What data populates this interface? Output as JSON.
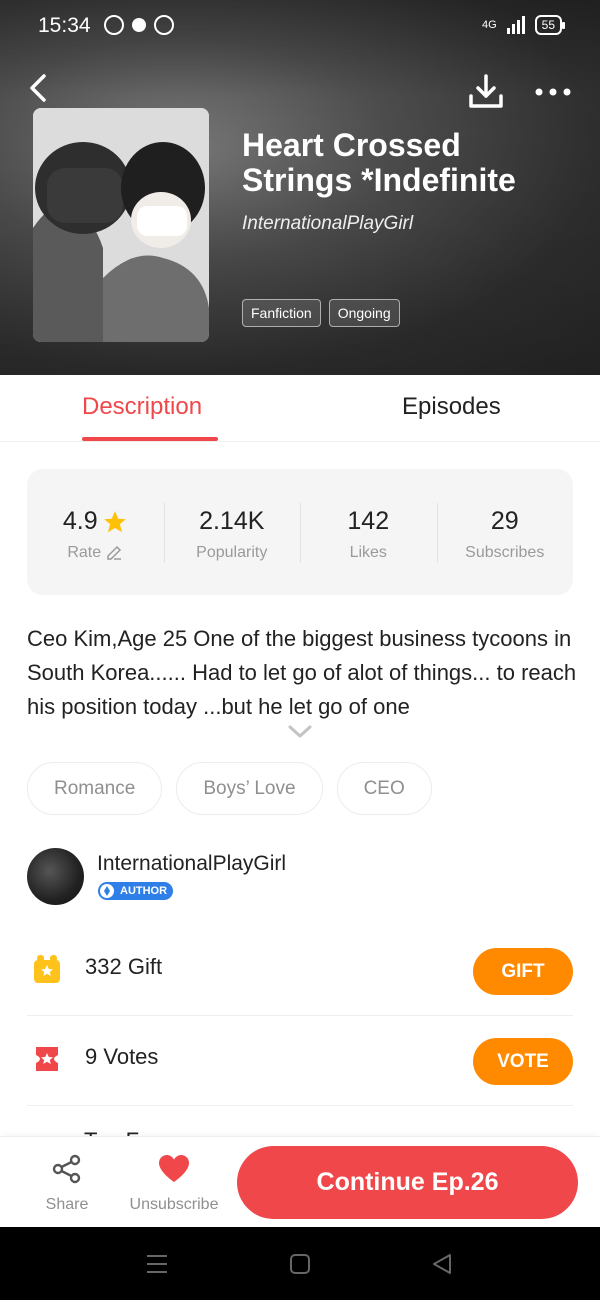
{
  "status_bar": {
    "time": "15:34",
    "network": "4G",
    "battery": "55"
  },
  "book": {
    "title": "Heart Crossed Strings *Indefinite",
    "author": "InternationalPlayGirl",
    "tags": [
      "Fanfiction",
      "Ongoing"
    ]
  },
  "tabs": {
    "description": "Description",
    "episodes": "Episodes"
  },
  "stats": [
    {
      "value": "4.9",
      "label": "Rate"
    },
    {
      "value": "2.14K",
      "label": "Popularity"
    },
    {
      "value": "142",
      "label": "Likes"
    },
    {
      "value": "29",
      "label": "Subscribes"
    }
  ],
  "synopsis": "Ceo Kim,Age 25 One of the biggest business tycoons in South Korea...... Had to let go of alot of things... to reach his position today ...but he let go of one",
  "keywords": [
    "Romance",
    "Boys’ Love",
    "CEO"
  ],
  "author_section": {
    "name": "InternationalPlayGirl",
    "badge": "AUTHOR"
  },
  "gift": {
    "count": "332",
    "label": "Gift",
    "button": "GIFT"
  },
  "votes": {
    "count": "9",
    "label": "Votes",
    "button": "VOTE"
  },
  "top_fans": {
    "label": "Top Fans"
  },
  "bottom_bar": {
    "share": "Share",
    "unsubscribe": "Unsubscribe",
    "continue": "Continue Ep.26"
  },
  "colors": {
    "accent": "#f0474a",
    "orange": "#ff8a00",
    "star": "#ffc107",
    "badge_blue": "#2f7fe8"
  }
}
